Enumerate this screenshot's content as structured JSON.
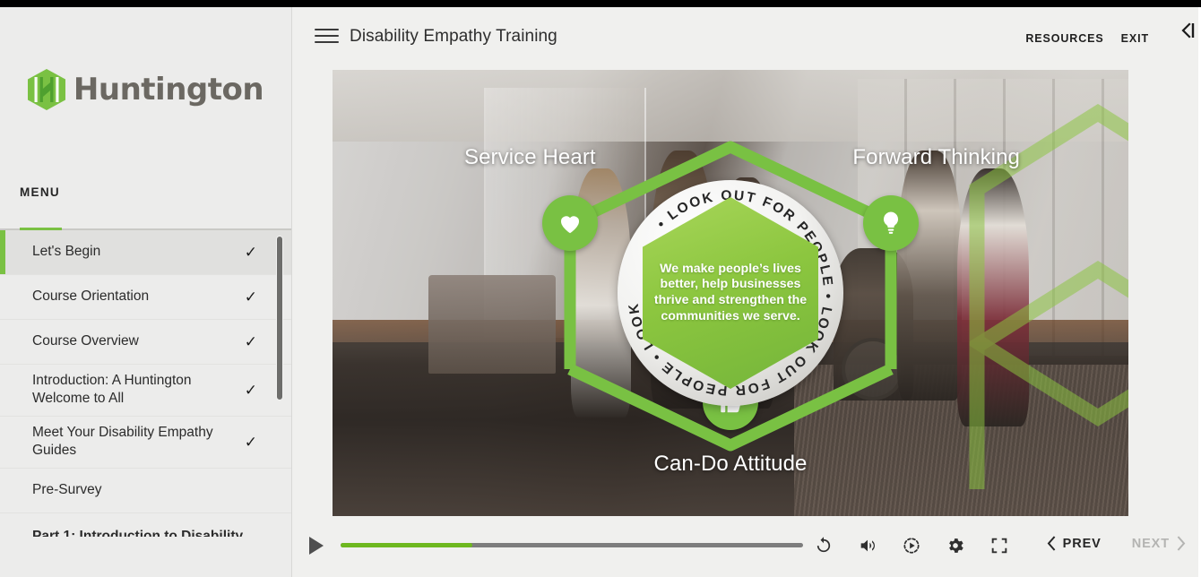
{
  "window": {
    "top_bar_color": "#000000",
    "accent_green": "#7ac143",
    "sidebar_bg": "#ececeb",
    "main_bg": "#f0f0ee"
  },
  "sidebar": {
    "logo": {
      "brand_name": "Huntington",
      "mark_icon": "huntington-hexagon-logo-icon",
      "mark_color": "#7ac143",
      "word_color": "#6b6862"
    },
    "menu_label": "MENU",
    "items": [
      {
        "label": "Let's Begin",
        "completed": true,
        "active": true,
        "check_icon": "checkmark-icon"
      },
      {
        "label": "Course Orientation",
        "completed": true,
        "active": false,
        "check_icon": "checkmark-icon"
      },
      {
        "label": "Course Overview",
        "completed": true,
        "active": false,
        "check_icon": "checkmark-icon"
      },
      {
        "label": "Introduction: A Huntington Welcome to All",
        "completed": true,
        "active": false,
        "check_icon": "checkmark-icon"
      },
      {
        "label": "Meet Your Disability Empathy Guides",
        "completed": true,
        "active": false,
        "check_icon": "checkmark-icon"
      },
      {
        "label": "Pre-Survey",
        "completed": false,
        "active": false,
        "check_icon": ""
      },
      {
        "label": "Part 1: Introduction to Disability",
        "completed": false,
        "active": false,
        "check_icon": ""
      }
    ],
    "scrollbar": {
      "name": "menu-scrollbar"
    }
  },
  "header": {
    "menu_icon": "hamburger-menu-icon",
    "title": "Disability Empathy Training",
    "links": [
      {
        "label": "RESOURCES",
        "name": "resources-link"
      },
      {
        "label": "EXIT",
        "name": "exit-link"
      }
    ],
    "collapse_icon": "collapse-panel-icon"
  },
  "stage": {
    "scene_description": "Office lobby with employees walking, including a person using a wheelchair",
    "graphic": {
      "nodes": [
        {
          "label": "Service Heart",
          "icon": "heart-icon",
          "position": "top-left"
        },
        {
          "label": "Forward Thinking",
          "icon": "lightbulb-icon",
          "position": "top-right"
        },
        {
          "label": "Can-Do Attitude",
          "icon": "thumbs-up-icon",
          "position": "bottom-center"
        }
      ],
      "seal_ring_text": "• LOOK OUT FOR PEOPLE • LOOK OUT FOR PEOPLE • LOOK OUT FOR PEOPLE • LOOK OUT FOR PEOPLE",
      "seal_ring_phrase": "LOOK OUT FOR PEOPLE",
      "mission_statement": "We make people’s lives better, help businesses thrive and strengthen the communities we serve.",
      "hexagon_color": "#8cc63f"
    }
  },
  "controls": {
    "play_icon": "play-icon",
    "progress_percent": 28.5,
    "icons": [
      {
        "name": "replay-icon",
        "label": "Replay"
      },
      {
        "name": "volume-icon",
        "label": "Volume"
      },
      {
        "name": "playback-speed-icon",
        "label": "Playback speed"
      },
      {
        "name": "settings-gear-icon",
        "label": "Settings"
      },
      {
        "name": "fullscreen-icon",
        "label": "Fullscreen"
      }
    ],
    "prev": {
      "label": "PREV",
      "icon": "chevron-left-icon",
      "enabled": true
    },
    "next": {
      "label": "NEXT",
      "icon": "chevron-right-icon",
      "enabled": false
    }
  }
}
